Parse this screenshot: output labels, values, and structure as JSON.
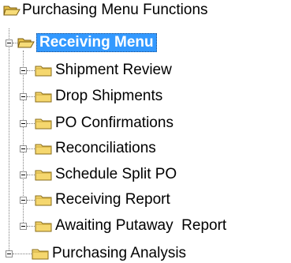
{
  "tree": {
    "root": {
      "label": "Purchasing Menu Functions",
      "icon": "open-folder-icon"
    },
    "selected_node": {
      "label": "Receiving Menu",
      "icon": "open-folder-icon",
      "expanded": true,
      "children": [
        {
          "label": "Shipment Review",
          "icon": "folder-icon",
          "expanded": false
        },
        {
          "label": "Drop Shipments",
          "icon": "folder-icon",
          "expanded": false
        },
        {
          "label": "PO Confirmations",
          "icon": "folder-icon",
          "expanded": false
        },
        {
          "label": "Reconciliations",
          "icon": "folder-icon",
          "expanded": false
        },
        {
          "label": "Schedule Split PO",
          "icon": "folder-icon",
          "expanded": false
        },
        {
          "label": "Receiving Report",
          "icon": "folder-icon",
          "expanded": false
        },
        {
          "label": "Awaiting Putaway  Report",
          "icon": "folder-icon",
          "expanded": false
        }
      ]
    },
    "sibling_node": {
      "label": "Purchasing Analysis",
      "icon": "folder-icon",
      "expanded": false
    }
  },
  "colors": {
    "selection_bg": "#3399ff",
    "folder_fill": "#f5d76e",
    "folder_edge": "#8a6d1a",
    "connector": "#808080"
  }
}
